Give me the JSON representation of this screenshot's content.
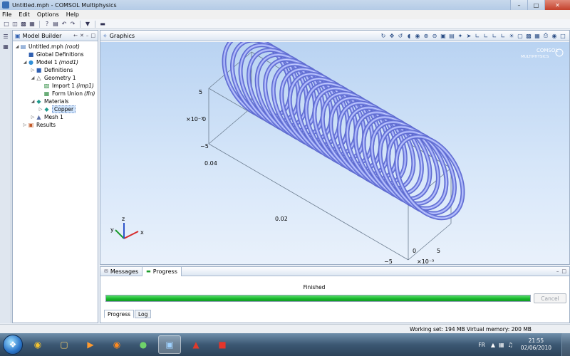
{
  "window": {
    "title": "Untitled.mph - COMSOL Multiphysics",
    "minimize": "–",
    "maximize": "□",
    "close": "✕"
  },
  "menu": [
    "File",
    "Edit",
    "Options",
    "Help"
  ],
  "model_builder": {
    "tab_label": "Model Builder",
    "tree": [
      {
        "label": "Untitled.mph",
        "suffix": "(root)",
        "depth": 0,
        "expander": "◢",
        "icon": "file-icon",
        "glyph": "▤",
        "color": "#3b6fb7"
      },
      {
        "label": "Global Definitions",
        "suffix": "",
        "depth": 1,
        "expander": "",
        "icon": "global-definitions-icon",
        "glyph": "■",
        "color": "#2f5fb0"
      },
      {
        "label": "Model 1",
        "suffix": "(mod1)",
        "depth": 1,
        "expander": "◢",
        "icon": "model-icon",
        "glyph": "●",
        "color": "#2f8fd8"
      },
      {
        "label": "Definitions",
        "suffix": "",
        "depth": 2,
        "expander": "▷",
        "icon": "definitions-icon",
        "glyph": "■",
        "color": "#2f5fb0"
      },
      {
        "label": "Geometry 1",
        "suffix": "",
        "depth": 2,
        "expander": "◢",
        "icon": "geometry-icon",
        "glyph": "△",
        "color": "#444"
      },
      {
        "label": "Import 1",
        "suffix": "(imp1)",
        "depth": 3,
        "expander": "",
        "icon": "import-icon",
        "glyph": "▧",
        "color": "#2b8a3e"
      },
      {
        "label": "Form Union",
        "suffix": "(fin)",
        "depth": 3,
        "expander": "",
        "icon": "form-union-icon",
        "glyph": "▦",
        "color": "#2b8a3e"
      },
      {
        "label": "Materials",
        "suffix": "",
        "depth": 2,
        "expander": "◢",
        "icon": "materials-icon",
        "glyph": "◆",
        "color": "#1e9a8c"
      },
      {
        "label": "Copper",
        "suffix": "",
        "depth": 3,
        "expander": "▷",
        "icon": "copper-material-icon",
        "glyph": "◆",
        "color": "#1e9a8c",
        "selected": true
      },
      {
        "label": "Mesh 1",
        "suffix": "",
        "depth": 2,
        "expander": "▷",
        "icon": "mesh-icon",
        "glyph": "▲",
        "color": "#5b6fa8"
      },
      {
        "label": "Results",
        "suffix": "",
        "depth": 1,
        "expander": "▷",
        "icon": "results-icon",
        "glyph": "▣",
        "color": "#c35b2a"
      }
    ]
  },
  "graphics": {
    "tab_label": "Graphics",
    "logo_line1": "COMSOL",
    "logo_line2": "MULTIPHYSICS",
    "axis_labels": {
      "z_top": "5",
      "z_exp": "×10⁻³",
      "z_zero": "0",
      "z_bottom": "−5",
      "y_far": "0.04",
      "y_mid": "0.02",
      "x_right": "5",
      "x_zero": "0",
      "x_left": "−5",
      "x_exp": "×10⁻³"
    },
    "triad": {
      "x": "x",
      "y": "y",
      "z": "z"
    },
    "coil_color": "#8f9cf0"
  },
  "bottom": {
    "tabs": [
      {
        "label": "Messages",
        "icon": "messages-icon",
        "active": false
      },
      {
        "label": "Progress",
        "icon": "progress-icon",
        "active": true
      }
    ],
    "status": "Finished",
    "progress_percent": 100,
    "cancel_label": "Cancel",
    "sub_tabs": [
      {
        "label": "Progress",
        "active": true
      },
      {
        "label": "Log",
        "active": false
      }
    ]
  },
  "statusbar": {
    "memory": "Working set: 194 MB  Virtual memory: 200 MB"
  },
  "taskbar": {
    "language": "FR",
    "time": "21:55",
    "date": "02/06/2010"
  }
}
